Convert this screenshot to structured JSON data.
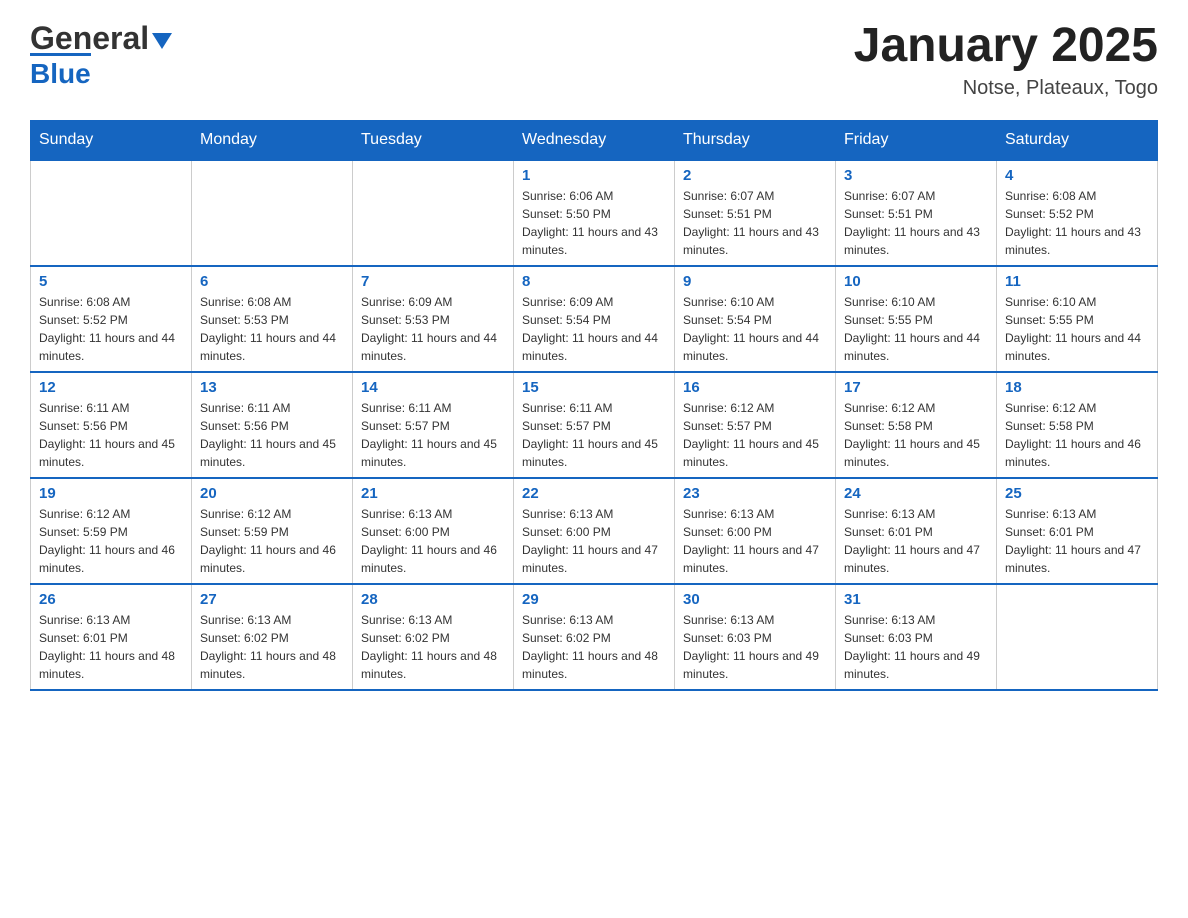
{
  "header": {
    "logo_text_black": "General",
    "logo_text_blue": "Blue",
    "month_title": "January 2025",
    "location": "Notse, Plateaux, Togo"
  },
  "days_of_week": [
    "Sunday",
    "Monday",
    "Tuesday",
    "Wednesday",
    "Thursday",
    "Friday",
    "Saturday"
  ],
  "weeks": [
    [
      {
        "day": "",
        "info": ""
      },
      {
        "day": "",
        "info": ""
      },
      {
        "day": "",
        "info": ""
      },
      {
        "day": "1",
        "info": "Sunrise: 6:06 AM\nSunset: 5:50 PM\nDaylight: 11 hours and 43 minutes."
      },
      {
        "day": "2",
        "info": "Sunrise: 6:07 AM\nSunset: 5:51 PM\nDaylight: 11 hours and 43 minutes."
      },
      {
        "day": "3",
        "info": "Sunrise: 6:07 AM\nSunset: 5:51 PM\nDaylight: 11 hours and 43 minutes."
      },
      {
        "day": "4",
        "info": "Sunrise: 6:08 AM\nSunset: 5:52 PM\nDaylight: 11 hours and 43 minutes."
      }
    ],
    [
      {
        "day": "5",
        "info": "Sunrise: 6:08 AM\nSunset: 5:52 PM\nDaylight: 11 hours and 44 minutes."
      },
      {
        "day": "6",
        "info": "Sunrise: 6:08 AM\nSunset: 5:53 PM\nDaylight: 11 hours and 44 minutes."
      },
      {
        "day": "7",
        "info": "Sunrise: 6:09 AM\nSunset: 5:53 PM\nDaylight: 11 hours and 44 minutes."
      },
      {
        "day": "8",
        "info": "Sunrise: 6:09 AM\nSunset: 5:54 PM\nDaylight: 11 hours and 44 minutes."
      },
      {
        "day": "9",
        "info": "Sunrise: 6:10 AM\nSunset: 5:54 PM\nDaylight: 11 hours and 44 minutes."
      },
      {
        "day": "10",
        "info": "Sunrise: 6:10 AM\nSunset: 5:55 PM\nDaylight: 11 hours and 44 minutes."
      },
      {
        "day": "11",
        "info": "Sunrise: 6:10 AM\nSunset: 5:55 PM\nDaylight: 11 hours and 44 minutes."
      }
    ],
    [
      {
        "day": "12",
        "info": "Sunrise: 6:11 AM\nSunset: 5:56 PM\nDaylight: 11 hours and 45 minutes."
      },
      {
        "day": "13",
        "info": "Sunrise: 6:11 AM\nSunset: 5:56 PM\nDaylight: 11 hours and 45 minutes."
      },
      {
        "day": "14",
        "info": "Sunrise: 6:11 AM\nSunset: 5:57 PM\nDaylight: 11 hours and 45 minutes."
      },
      {
        "day": "15",
        "info": "Sunrise: 6:11 AM\nSunset: 5:57 PM\nDaylight: 11 hours and 45 minutes."
      },
      {
        "day": "16",
        "info": "Sunrise: 6:12 AM\nSunset: 5:57 PM\nDaylight: 11 hours and 45 minutes."
      },
      {
        "day": "17",
        "info": "Sunrise: 6:12 AM\nSunset: 5:58 PM\nDaylight: 11 hours and 45 minutes."
      },
      {
        "day": "18",
        "info": "Sunrise: 6:12 AM\nSunset: 5:58 PM\nDaylight: 11 hours and 46 minutes."
      }
    ],
    [
      {
        "day": "19",
        "info": "Sunrise: 6:12 AM\nSunset: 5:59 PM\nDaylight: 11 hours and 46 minutes."
      },
      {
        "day": "20",
        "info": "Sunrise: 6:12 AM\nSunset: 5:59 PM\nDaylight: 11 hours and 46 minutes."
      },
      {
        "day": "21",
        "info": "Sunrise: 6:13 AM\nSunset: 6:00 PM\nDaylight: 11 hours and 46 minutes."
      },
      {
        "day": "22",
        "info": "Sunrise: 6:13 AM\nSunset: 6:00 PM\nDaylight: 11 hours and 47 minutes."
      },
      {
        "day": "23",
        "info": "Sunrise: 6:13 AM\nSunset: 6:00 PM\nDaylight: 11 hours and 47 minutes."
      },
      {
        "day": "24",
        "info": "Sunrise: 6:13 AM\nSunset: 6:01 PM\nDaylight: 11 hours and 47 minutes."
      },
      {
        "day": "25",
        "info": "Sunrise: 6:13 AM\nSunset: 6:01 PM\nDaylight: 11 hours and 47 minutes."
      }
    ],
    [
      {
        "day": "26",
        "info": "Sunrise: 6:13 AM\nSunset: 6:01 PM\nDaylight: 11 hours and 48 minutes."
      },
      {
        "day": "27",
        "info": "Sunrise: 6:13 AM\nSunset: 6:02 PM\nDaylight: 11 hours and 48 minutes."
      },
      {
        "day": "28",
        "info": "Sunrise: 6:13 AM\nSunset: 6:02 PM\nDaylight: 11 hours and 48 minutes."
      },
      {
        "day": "29",
        "info": "Sunrise: 6:13 AM\nSunset: 6:02 PM\nDaylight: 11 hours and 48 minutes."
      },
      {
        "day": "30",
        "info": "Sunrise: 6:13 AM\nSunset: 6:03 PM\nDaylight: 11 hours and 49 minutes."
      },
      {
        "day": "31",
        "info": "Sunrise: 6:13 AM\nSunset: 6:03 PM\nDaylight: 11 hours and 49 minutes."
      },
      {
        "day": "",
        "info": ""
      }
    ]
  ]
}
